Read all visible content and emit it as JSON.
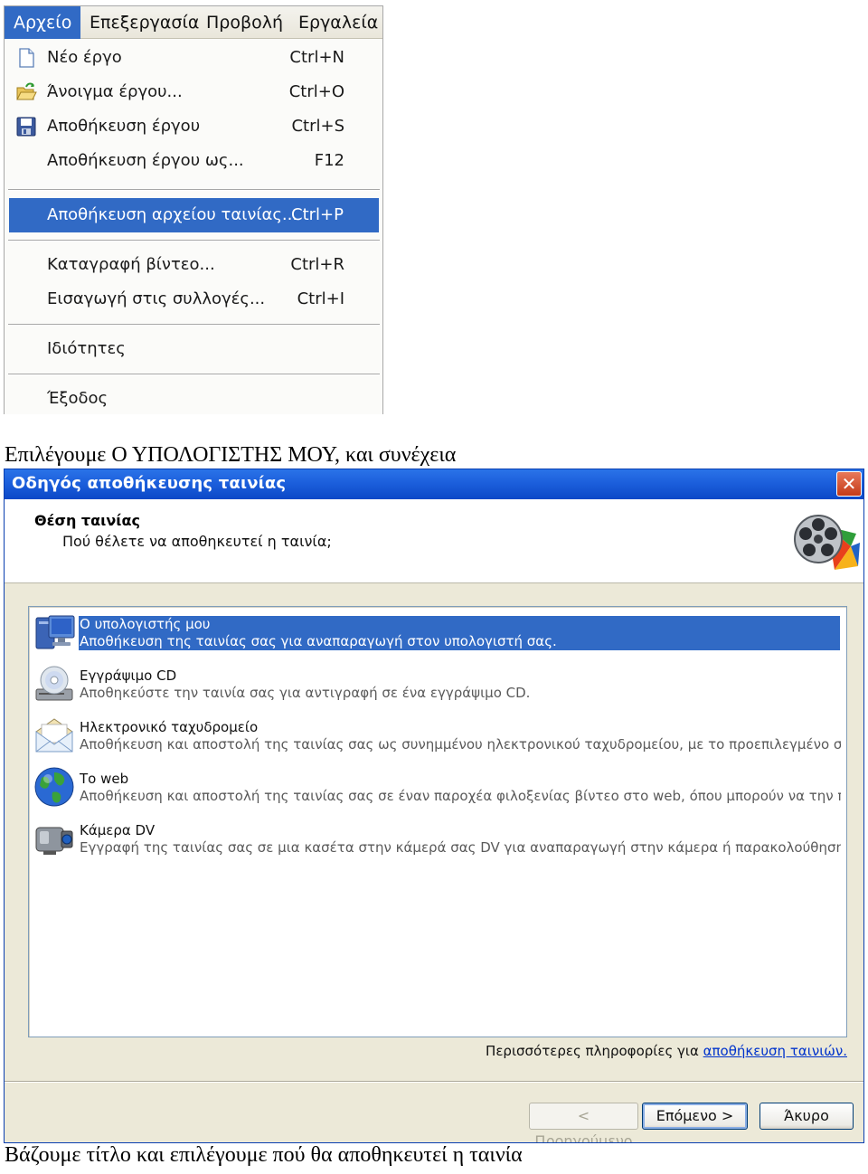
{
  "menu": {
    "menubar": [
      "Αρχείο",
      "Επεξεργασία",
      "Προβολή",
      "Εργαλεία"
    ],
    "active_index": 0,
    "items": [
      {
        "label": "Νέο έργο",
        "shortcut": "Ctrl+N",
        "icon": "new-document-icon"
      },
      {
        "label": "Άνοιγμα έργου...",
        "shortcut": "Ctrl+O",
        "icon": "open-folder-icon"
      },
      {
        "label": "Αποθήκευση έργου",
        "shortcut": "Ctrl+S",
        "icon": "save-disk-icon"
      },
      {
        "label": "Αποθήκευση έργου ως...",
        "shortcut": "F12"
      },
      {
        "label": "Αποθήκευση αρχείου ταινίας...",
        "shortcut": "Ctrl+P",
        "selected": true
      },
      {
        "label": "Καταγραφή βίντεο...",
        "shortcut": "Ctrl+R"
      },
      {
        "label": "Εισαγωγή στις συλλογές...",
        "shortcut": "Ctrl+I"
      },
      {
        "label": "Ιδιότητες",
        "shortcut": ""
      },
      {
        "label": "Έξοδος",
        "shortcut": ""
      }
    ]
  },
  "captions": {
    "first": "Επιλέγουμε Ο ΥΠΟΛΟΓΙΣΤΗΣ ΜΟΥ, και συνέχεια",
    "second": "Βάζουμε τίτλο και επιλέγουμε πού θα αποθηκευτεί η ταινία"
  },
  "wizard": {
    "title": "Οδηγός αποθήκευσης ταινίας",
    "header_title": "Θέση ταινίας",
    "header_subtitle": "Πού θέλετε να αποθηκευτεί η ταινία;",
    "options": [
      {
        "title": "Ο υπολογιστής μου",
        "description": "Αποθήκευση της ταινίας σας για αναπαραγωγή στον υπολογιστή σας.",
        "icon": "computer-icon",
        "selected": true
      },
      {
        "title": "Εγγράψιμο CD",
        "description": "Αποθηκεύστε την ταινία σας για αντιγραφή σε ένα εγγράψιμο CD.",
        "icon": "cd-drive-icon"
      },
      {
        "title": "Ηλεκτρονικό ταχυδρομείο",
        "description": "Αποθήκευση και αποστολή της ταινίας σας ως συνημμένου ηλεκτρονικού ταχυδρομείου, με το προεπιλεγμένο σας πρόγ...",
        "icon": "envelope-icon"
      },
      {
        "title": "Το web",
        "description": "Αποθήκευση και αποστολή της ταινίας σας σε έναν παροχέα φιλοξενίας βίντεο στο web, όπου μπορούν να την παρακολ...",
        "icon": "globe-icon"
      },
      {
        "title": "Κάμερα DV",
        "description": "Εγγραφή της ταινίας σας σε μια κασέτα στην κάμερά σας DV για αναπαραγωγή στην κάμερα ή παρακολούθηση στην τηλ...",
        "icon": "camcorder-icon"
      }
    ],
    "more_info_text": "Περισσότερες πληροφορίες για ",
    "more_info_link": "αποθήκευση ταινιών.",
    "buttons": {
      "back": "< Προηγούμενο",
      "next": "Επόμενο >",
      "cancel": "Άκυρο"
    },
    "colors": {
      "title_bar": "#0b48c7",
      "selection": "#316ac5",
      "dialog_bg": "#ece9d8",
      "link": "#0033cc"
    }
  }
}
